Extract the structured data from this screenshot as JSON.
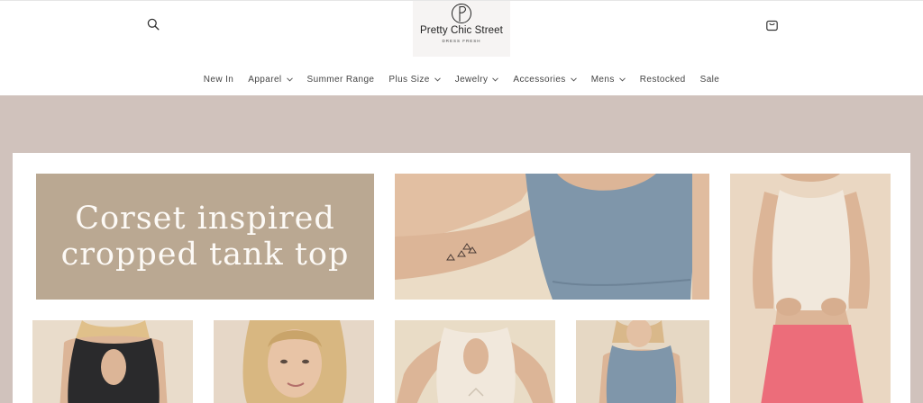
{
  "header": {
    "search_icon": "search-icon",
    "cart_icon": "shopping-bag-icon",
    "logo": {
      "name": "Pretty Chic Street",
      "tagline": "DRESS FRESH"
    }
  },
  "nav": {
    "items": [
      {
        "label": "New In",
        "has_dropdown": false
      },
      {
        "label": "Apparel",
        "has_dropdown": true
      },
      {
        "label": "Summer Range",
        "has_dropdown": false
      },
      {
        "label": "Plus Size",
        "has_dropdown": true
      },
      {
        "label": "Jewelry",
        "has_dropdown": true
      },
      {
        "label": "Accessories",
        "has_dropdown": true
      },
      {
        "label": "Mens",
        "has_dropdown": true
      },
      {
        "label": "Restocked",
        "has_dropdown": false
      },
      {
        "label": "Sale",
        "has_dropdown": false
      }
    ]
  },
  "hero": {
    "title_line1": "Corset inspired",
    "title_line2": "cropped tank top",
    "colors": {
      "background": "#d0c2bc",
      "title_card": "#baa892",
      "blue_top": "#7f96aa",
      "cream_top": "#f1e8dc",
      "pink_skirt": "#ec6d7a",
      "black_top": "#2a2a2c"
    }
  }
}
